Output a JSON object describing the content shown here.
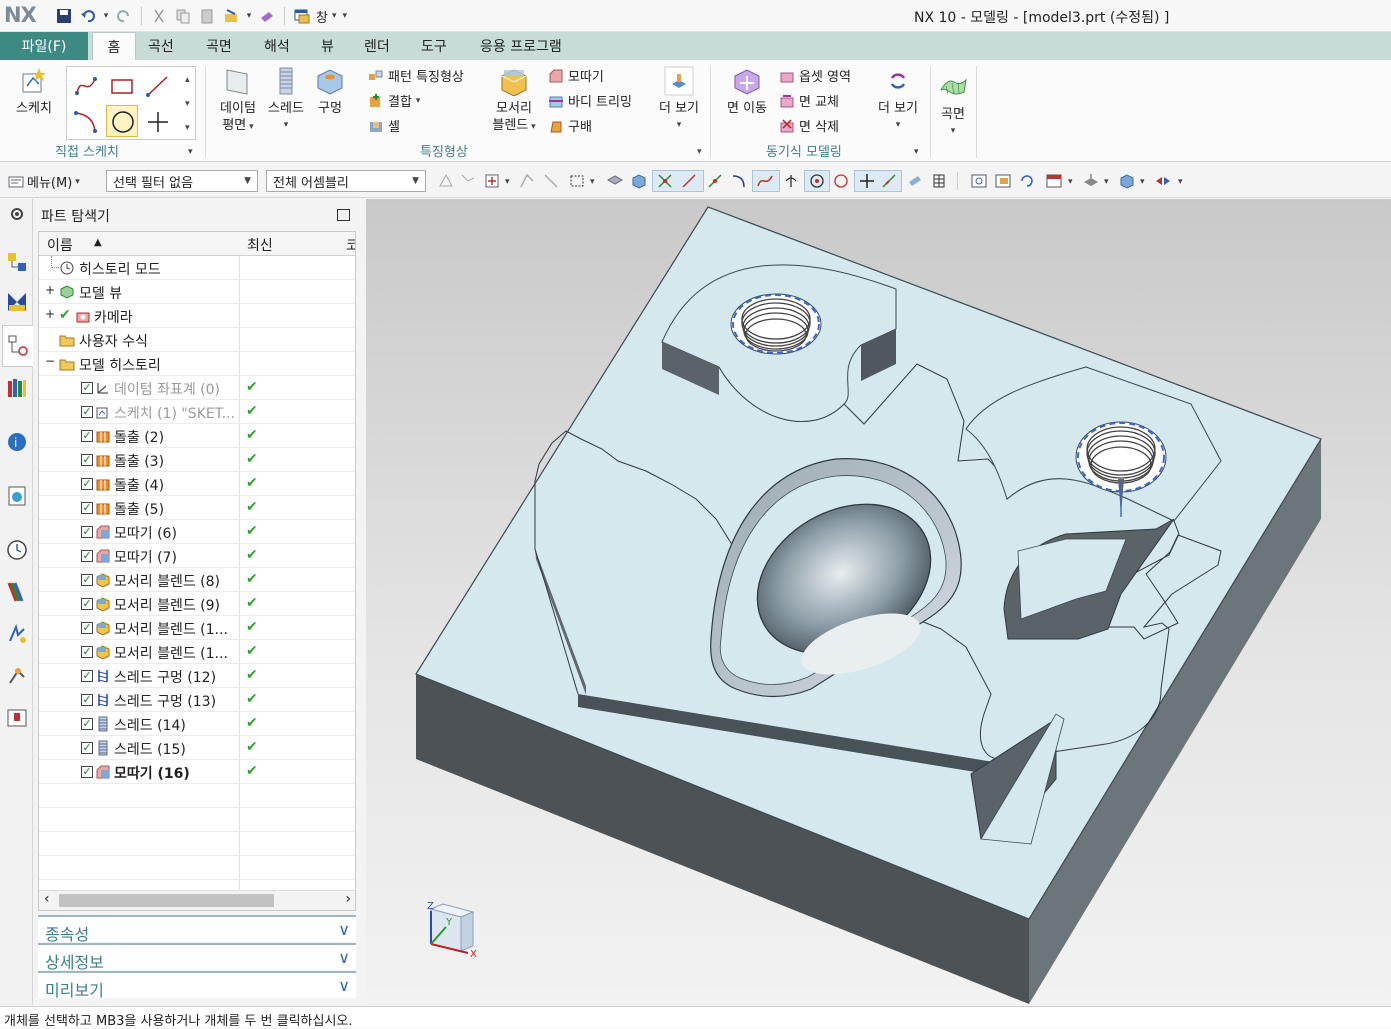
{
  "app": {
    "logo": "NX",
    "window_title": "NX 10 - 모델링 - [model3.prt (수정됨) ]",
    "qat_window_label": "창"
  },
  "ribbon_tabs": {
    "file": "파일(F)",
    "home": "홈",
    "curve": "곡선",
    "surface": "곡면",
    "analysis": "해석",
    "view": "뷰",
    "render": "렌더",
    "tools": "도구",
    "apps": "응용 프로그램"
  },
  "ribbon": {
    "sketch_group": {
      "label": "직접 스케치",
      "sketch": "스케치"
    },
    "feature_group": {
      "label": "특징형상",
      "datum_plane_1": "데이텀",
      "datum_plane_2": "평면",
      "thread": "스레드",
      "hole": "구멍",
      "pattern_feature": "패턴 특징형상",
      "combine": "결합",
      "shell": "셸",
      "edge_blend_1": "모서리",
      "edge_blend_2": "블렌드",
      "chamfer": "모따기",
      "trim_body": "바디 트리밍",
      "sphere": "구배",
      "more": "더 보기"
    },
    "sync_group": {
      "label": "동기식 모델링",
      "move_face": "면 이동",
      "offset_region": "옵셋 영역",
      "replace_face": "면 교체",
      "delete_face": "면 삭제",
      "more": "더 보기"
    },
    "surface_group": {
      "surface": "곡면"
    }
  },
  "command_bar": {
    "menu": "메뉴(M)",
    "filter": "선택 필터 없음",
    "assembly": "전체 어셈블리"
  },
  "part_navigator": {
    "title": "파트 탐색기",
    "col_name": "이름",
    "col_latest": "최신",
    "col_third": "코",
    "rows": [
      {
        "label": "히스토리 모드"
      },
      {
        "label": "모델 뷰"
      },
      {
        "label": "카메라"
      },
      {
        "label": "사용자 수식"
      },
      {
        "label": "모델 히스토리"
      },
      {
        "label": "데이텀 좌표계 (0)"
      },
      {
        "label": "스케치 (1) \"SKET..."
      },
      {
        "label": "돌출 (2)"
      },
      {
        "label": "돌출 (3)"
      },
      {
        "label": "돌출 (4)"
      },
      {
        "label": "돌출 (5)"
      },
      {
        "label": "모따기 (6)"
      },
      {
        "label": "모따기 (7)"
      },
      {
        "label": "모서리 블렌드 (8)"
      },
      {
        "label": "모서리 블렌드 (9)"
      },
      {
        "label": "모서리 블렌드 (1..."
      },
      {
        "label": "모서리 블렌드 (1..."
      },
      {
        "label": "스레드 구멍 (12)"
      },
      {
        "label": "스레드 구멍 (13)"
      },
      {
        "label": "스레드 (14)"
      },
      {
        "label": "스레드 (15)"
      },
      {
        "label": "모따기 (16)"
      }
    ],
    "accordion": {
      "dependency": "종속성",
      "details": "상세정보",
      "preview": "미리보기"
    }
  },
  "triad": {
    "z": "Z",
    "y": "Y",
    "x": "X"
  },
  "status_bar": {
    "message": "개체를 선택하고 MB3을 사용하거나 개체를 두 번 클릭하십시오."
  }
}
